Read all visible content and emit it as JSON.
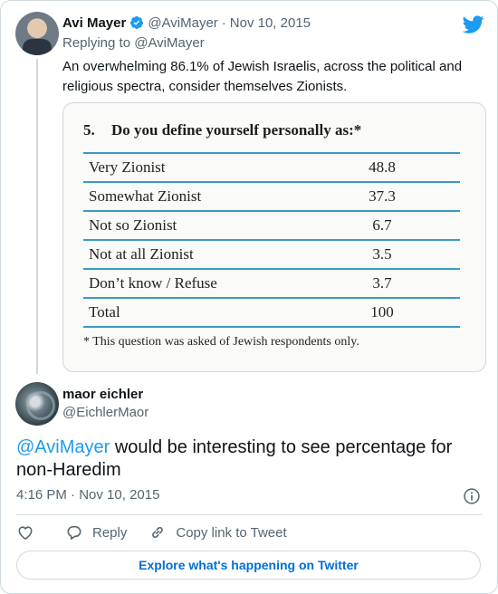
{
  "parent_tweet": {
    "display_name": "Avi Mayer",
    "handle": "@AviMayer",
    "separator": "·",
    "date": "Nov 10, 2015",
    "replying_to_prefix": "Replying to",
    "replying_to_handle": "@AviMayer",
    "text": "An overwhelming 86.1% of Jewish Israelis, across the political and religious spectra, consider themselves Zionists.",
    "media": {
      "question_number": "5.",
      "question": "Do you define yourself personally as:*",
      "rows": [
        {
          "label": "Very Zionist",
          "value": "48.8"
        },
        {
          "label": "Somewhat Zionist",
          "value": "37.3"
        },
        {
          "label": "Not so Zionist",
          "value": "6.7"
        },
        {
          "label": "Not at all Zionist",
          "value": "3.5"
        },
        {
          "label": "Don’t know / Refuse",
          "value": "3.7"
        },
        {
          "label": "Total",
          "value": "100"
        }
      ],
      "footnote": "*  This question was asked of Jewish respondents only."
    }
  },
  "tweet": {
    "display_name": "maor eichler",
    "handle": "@EichlerMaor",
    "mention": "@AviMayer",
    "text": " would be interesting to see percentage for non-Haredim",
    "time": "4:16 PM",
    "separator": "·",
    "date": "Nov 10, 2015"
  },
  "actions": {
    "reply_label": "Reply",
    "copy_link_label": "Copy link to Tweet"
  },
  "explore_label": "Explore what's happening on Twitter",
  "colors": {
    "twitter_blue": "#1d9bf0",
    "text": "#0f1419",
    "secondary": "#536471",
    "border": "#cfd9de",
    "table_rule": "#3a9bc0"
  },
  "icons": [
    "verified-badge-icon",
    "twitter-logo-icon",
    "heart-icon",
    "reply-icon",
    "link-icon",
    "info-icon"
  ]
}
